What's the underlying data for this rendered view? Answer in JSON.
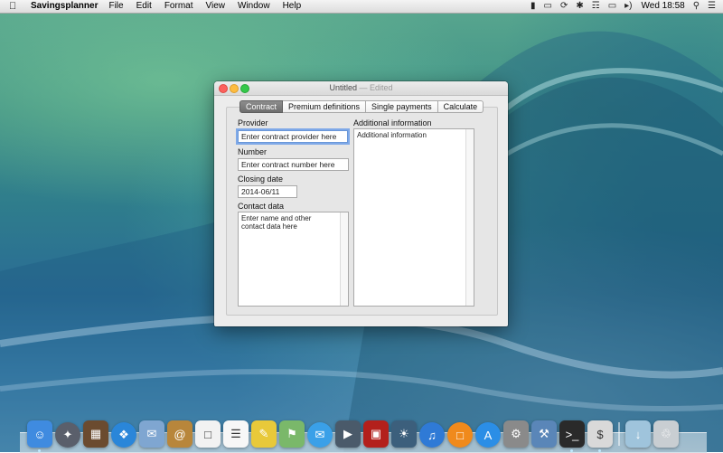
{
  "menubar": {
    "apple": "",
    "app_name": "Savingsplanner",
    "items": [
      "File",
      "Edit",
      "Format",
      "View",
      "Window",
      "Help"
    ],
    "clock": "Wed 18:58"
  },
  "window": {
    "title": "Untitled",
    "title_separator": "—",
    "title_status": "Edited"
  },
  "tabs": [
    "Contract",
    "Premium definitions",
    "Single payments",
    "Calculate"
  ],
  "active_tab": "Contract",
  "form": {
    "provider_label": "Provider",
    "provider_value": "Enter contract provider here",
    "number_label": "Number",
    "number_value": "Enter contract number here",
    "closing_date_label": "Closing date",
    "closing_date_value": "2014-06/11",
    "contact_label": "Contact data",
    "contact_value": "Enter name and other contact data here",
    "additional_label": "Additional information",
    "additional_value": "Additional information"
  },
  "dock": {
    "apps": [
      {
        "name": "Finder",
        "color": "#3f8be0",
        "running": true
      },
      {
        "name": "Launchpad",
        "color": "#5a5f6b",
        "running": false
      },
      {
        "name": "Mission Control",
        "color": "#6b4b2f",
        "running": false
      },
      {
        "name": "Safari",
        "color": "#2a86d9",
        "running": false
      },
      {
        "name": "Mail",
        "color": "#7fa6d1",
        "running": false
      },
      {
        "name": "Contacts",
        "color": "#b8863b",
        "running": false
      },
      {
        "name": "Calendar",
        "color": "#f2f2f2",
        "running": false
      },
      {
        "name": "Reminders",
        "color": "#f7f7f7",
        "running": false
      },
      {
        "name": "Notes",
        "color": "#e8c93a",
        "running": false
      },
      {
        "name": "Maps",
        "color": "#7ab86a",
        "running": false
      },
      {
        "name": "Messages",
        "color": "#3aa0e8",
        "running": false
      },
      {
        "name": "FaceTime",
        "color": "#4a5a6a",
        "running": false
      },
      {
        "name": "Photo Booth",
        "color": "#b3201c",
        "running": false
      },
      {
        "name": "iPhoto",
        "color": "#3c5f7c",
        "running": false
      },
      {
        "name": "iTunes",
        "color": "#2f7ad6",
        "running": false
      },
      {
        "name": "iBooks",
        "color": "#f08a1c",
        "running": false
      },
      {
        "name": "App Store",
        "color": "#2b8ee6",
        "running": false
      },
      {
        "name": "System Preferences",
        "color": "#8a8a8a",
        "running": false
      },
      {
        "name": "Xcode",
        "color": "#5a86b8",
        "running": false
      },
      {
        "name": "Terminal",
        "color": "#2a2a2a",
        "running": true
      },
      {
        "name": "Savingsplanner",
        "color": "#d9d9d9",
        "running": true
      }
    ],
    "stacks": [
      {
        "name": "Downloads",
        "color": "#9fc4dc"
      },
      {
        "name": "Trash",
        "color": "#c9ced2"
      }
    ]
  }
}
